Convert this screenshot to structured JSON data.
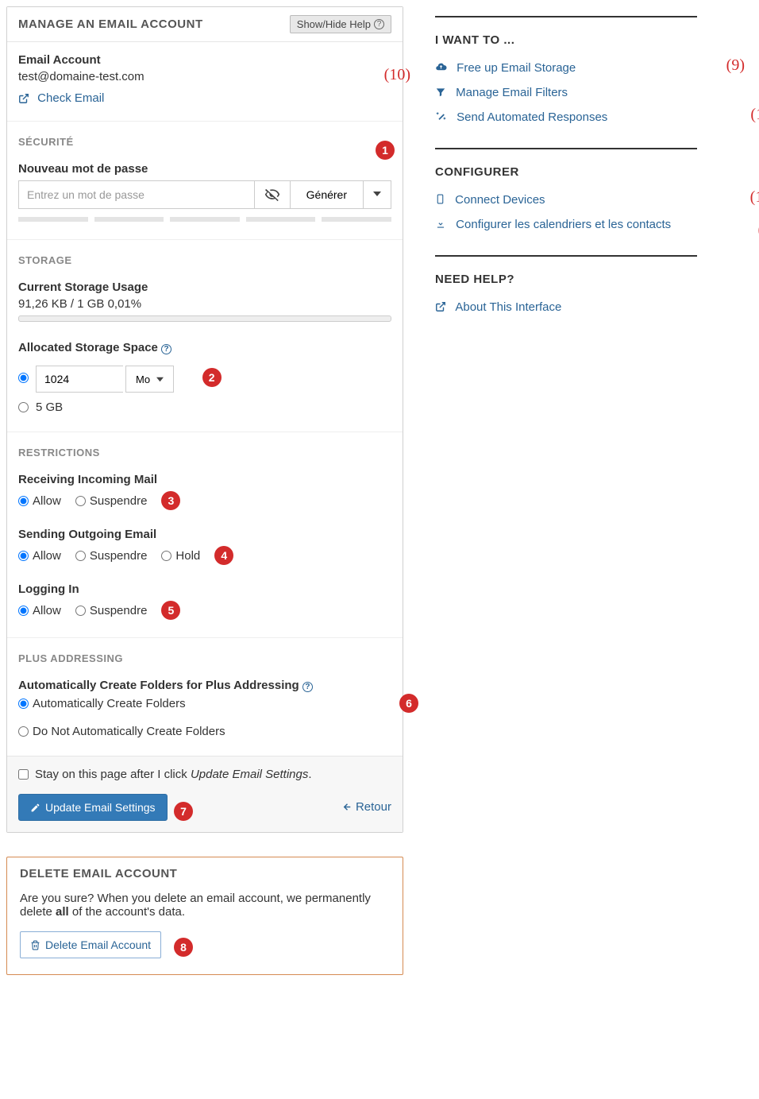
{
  "panel": {
    "title": "MANAGE AN EMAIL ACCOUNT",
    "help_btn": "Show/Hide Help",
    "account_label": "Email Account",
    "account_value": "test@domaine-test.com",
    "check_email": "Check Email"
  },
  "security": {
    "heading": "SÉCURITÉ",
    "new_pw_label": "Nouveau mot de passe",
    "placeholder": "Entrez un mot de passe",
    "generate": "Générer"
  },
  "storage": {
    "heading": "STORAGE",
    "usage_label": "Current Storage Usage",
    "usage_value": "91,26 KB / 1 GB 0,01%",
    "allocated_label": "Allocated Storage Space",
    "size_value": "1024",
    "unit": "Mo",
    "opt2": "5 GB"
  },
  "restrictions": {
    "heading": "RESTRICTIONS",
    "incoming_label": "Receiving Incoming Mail",
    "outgoing_label": "Sending Outgoing Email",
    "login_label": "Logging In",
    "allow": "Allow",
    "suspend": "Suspendre",
    "hold": "Hold"
  },
  "plus": {
    "heading": "PLUS ADDRESSING",
    "label": "Automatically Create Folders for Plus Addressing",
    "opt1": "Automatically Create Folders",
    "opt2": "Do Not Automatically Create Folders"
  },
  "footer": {
    "stay_label_a": "Stay on this page after I click ",
    "stay_label_b": "Update Email Settings",
    "update_btn": "Update Email Settings",
    "retour": "Retour"
  },
  "delete": {
    "heading": "DELETE EMAIL ACCOUNT",
    "text_a": "Are you sure? When you delete an email account, we permanently delete ",
    "bold": "all",
    "text_b": " of the account's data.",
    "btn": "Delete Email Account"
  },
  "right": {
    "want_heading": "I WANT TO ...",
    "free_storage": "Free up Email Storage",
    "manage_filters": "Manage Email Filters",
    "automated": "Send Automated Responses",
    "config_heading": "CONFIGURER",
    "connect": "Connect Devices",
    "calendars": "Configurer les calendriers et les contacts",
    "help_heading": "NEED HELP?",
    "about": "About This Interface"
  }
}
